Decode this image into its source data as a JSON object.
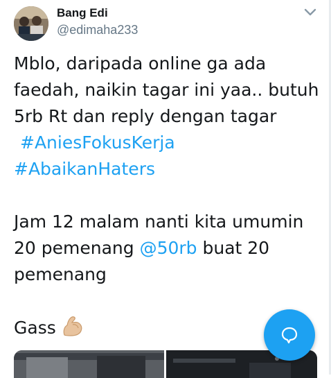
{
  "author": {
    "name": "Bang Edi",
    "handle": "@edimaha233"
  },
  "tweet": {
    "lines": [
      "Mblo, daripada online ga ada",
      "faedah, naikin tagar ini yaa.. butuh",
      "5rb Rt dan reply dengan tagar"
    ],
    "hashtags": [
      "#AniesFokusKerja",
      "#AbaikanHaters"
    ],
    "para2_line1": "Jam 12 malam nanti kita umumin",
    "para2_line2_pre": "20 pemenang ",
    "mention": "@50rb",
    "para2_line2_post": " buat 20",
    "para2_line3": "pemenang",
    "closing": "Gass",
    "closing_emoji": "flexed-biceps-emoji"
  },
  "icons": {
    "menu": "chevron-down-icon",
    "fab": "reply-bubble-icon"
  },
  "colors": {
    "accent": "#1da1f2",
    "text": "#14171a",
    "secondary": "#657786"
  }
}
